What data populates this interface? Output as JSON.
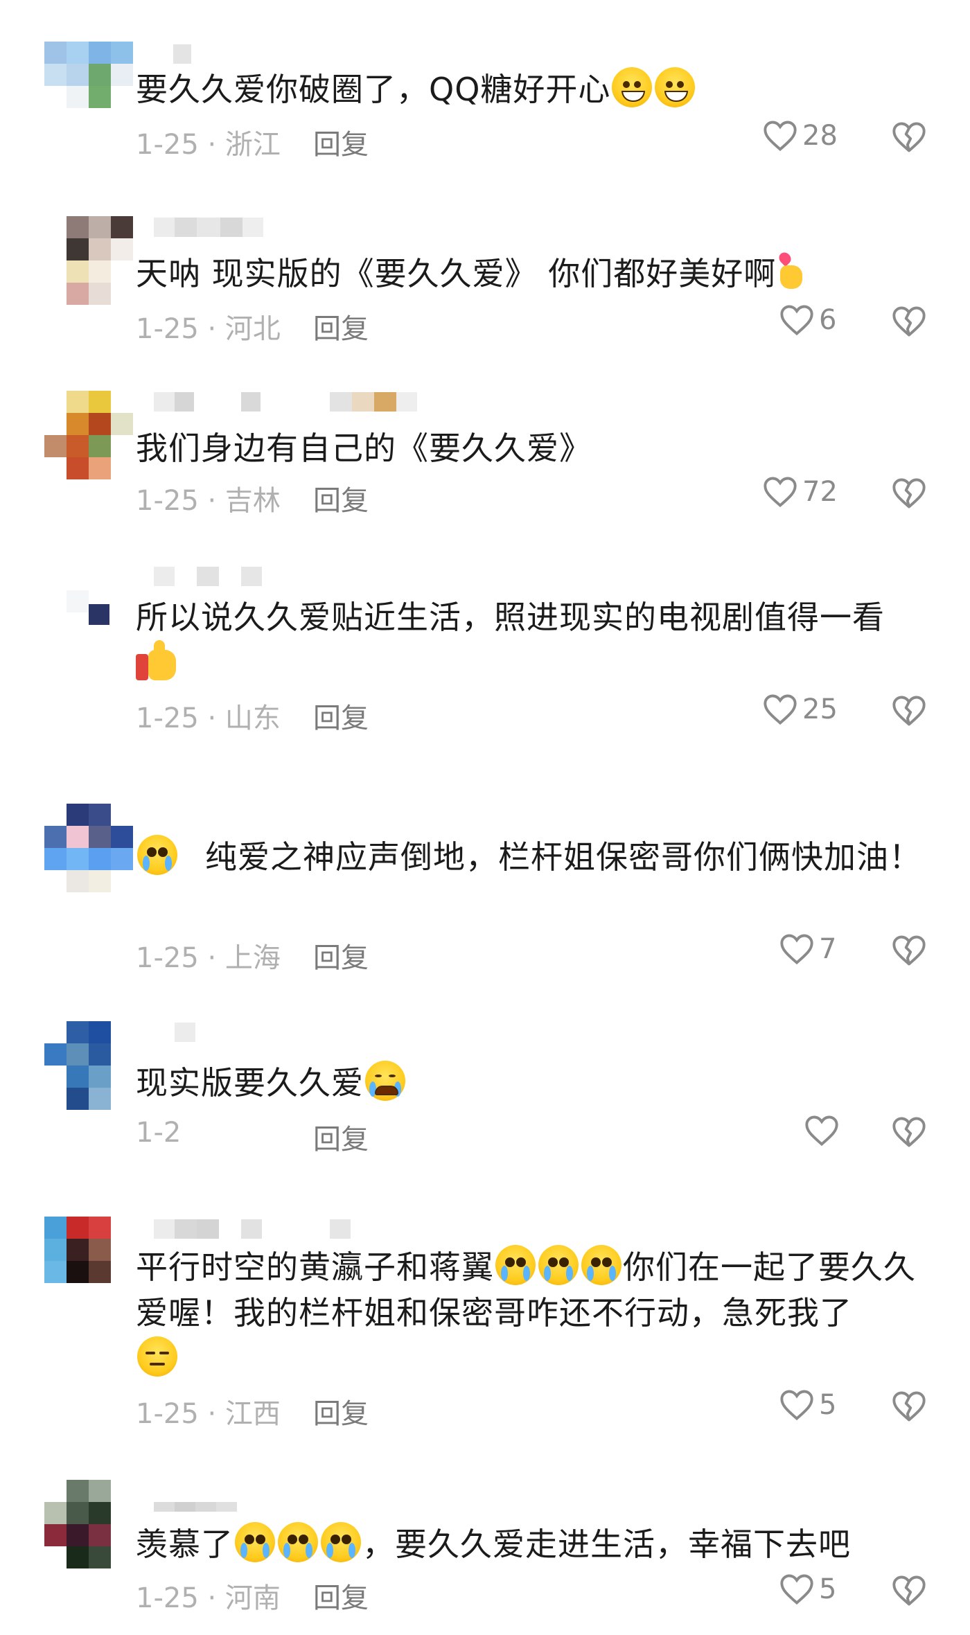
{
  "reply_label": "回复",
  "comments": [
    {
      "text_a": "要久久爱你破圈了，QQ糖好开心",
      "emojis_after": [
        "grin-emoji",
        "grin-emoji"
      ],
      "meta": "1-25 · 浙江",
      "likes": "28"
    },
    {
      "text_a": "天呐  现实版的《要久久爱》  你们都好美好啊",
      "emojis_after": [
        "finger-heart-emoji"
      ],
      "meta": "1-25 · 河北",
      "likes": "6"
    },
    {
      "text_a": "我们身边有自己的《要久久爱》",
      "meta": "1-25 · 吉林",
      "likes": "72"
    },
    {
      "text_a": "所以说久久爱贴近生活，照进现实的电视剧值得一看",
      "emojis_after": [
        "thumbs-up-emoji"
      ],
      "meta": "1-25 · 山东",
      "likes": "25"
    },
    {
      "text_a": "纯爱之神应声倒地，栏杆姐保密哥你们俩快加油！",
      "emojis_before": [
        "pleading-emoji"
      ],
      "meta": "1-25 · 上海",
      "likes": "7"
    },
    {
      "text_a": "现实版要久久爱",
      "emojis_after": [
        "crying-emoji"
      ],
      "meta": "1-2",
      "likes": ""
    },
    {
      "text_a": "平行时空的黄瀛子和蒋翼",
      "text_b": "你们在一起了要久久爱喔！我的栏杆姐和保密哥咋还不行动，急死我了",
      "meta": "1-25 · 江西",
      "likes": "5"
    },
    {
      "text_a": "羡慕了",
      "text_b": "，要久久爱走进生活，幸福下去吧",
      "meta": "1-25 · 河南",
      "likes": "5"
    }
  ],
  "colors": {
    "text": "#1b1b1b",
    "meta": "#b0b0b0",
    "reply": "#7a7a7a",
    "icon": "#8a8a8a"
  }
}
